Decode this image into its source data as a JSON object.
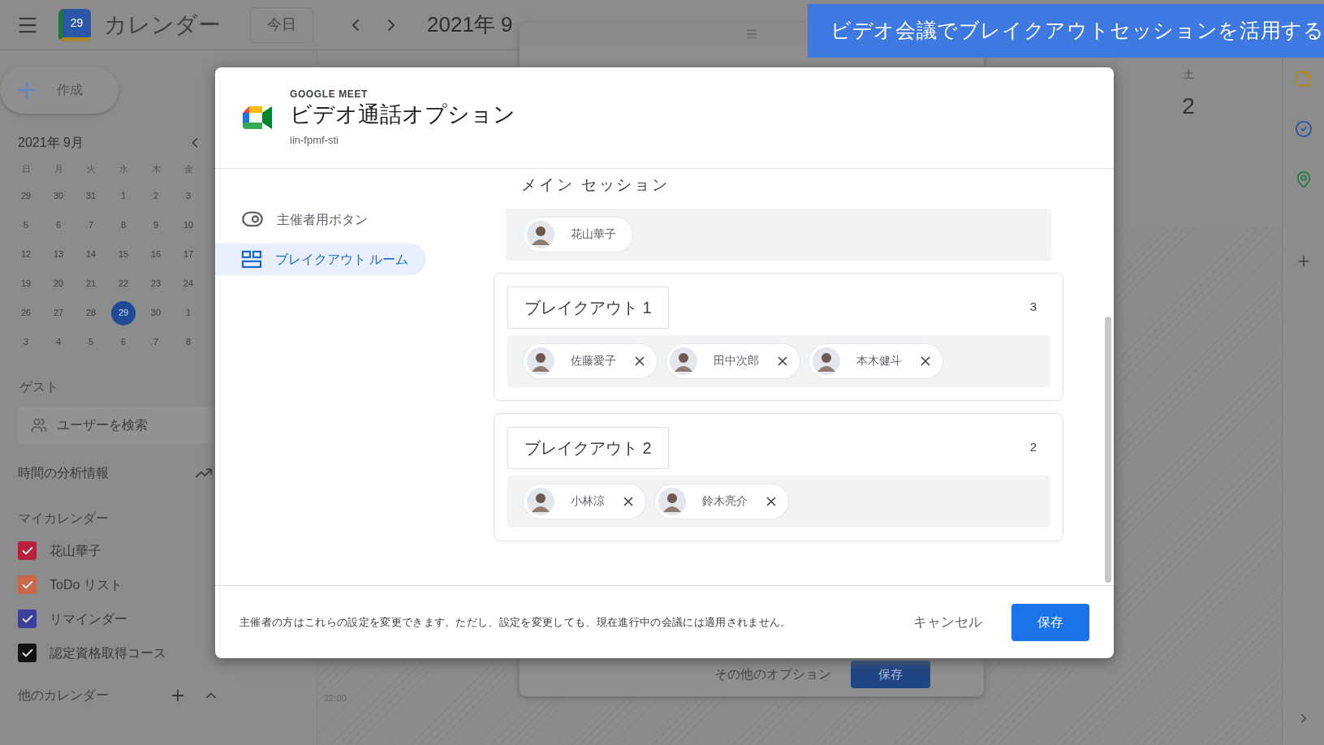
{
  "header": {
    "logo_text": "29",
    "app_name": "カレンダー",
    "today_button": "今日",
    "date_range": "2021年 9"
  },
  "banner": {
    "text": "ビデオ会議でブレイクアウトセッションを活用する"
  },
  "sidebar": {
    "create_button": "作成",
    "mini_calendar": {
      "title": "2021年 9月",
      "weekdays": [
        "日",
        "月",
        "火",
        "水",
        "木",
        "金"
      ],
      "weeks": [
        [
          {
            "label": "29",
            "selected": false
          },
          {
            "label": "30",
            "selected": false
          },
          {
            "label": "31",
            "selected": false
          },
          {
            "label": "1",
            "selected": false
          },
          {
            "label": "2",
            "selected": false
          },
          {
            "label": "3",
            "selected": false
          }
        ],
        [
          {
            "label": "5",
            "selected": false
          },
          {
            "label": "6",
            "selected": false
          },
          {
            "label": "7",
            "selected": false
          },
          {
            "label": "8",
            "selected": false
          },
          {
            "label": "9",
            "selected": false
          },
          {
            "label": "10",
            "selected": false
          }
        ],
        [
          {
            "label": "12",
            "selected": false
          },
          {
            "label": "13",
            "selected": false
          },
          {
            "label": "14",
            "selected": false
          },
          {
            "label": "15",
            "selected": false
          },
          {
            "label": "16",
            "selected": false
          },
          {
            "label": "17",
            "selected": false
          }
        ],
        [
          {
            "label": "19",
            "selected": false
          },
          {
            "label": "20",
            "selected": false
          },
          {
            "label": "21",
            "selected": false
          },
          {
            "label": "22",
            "selected": false
          },
          {
            "label": "23",
            "selected": false
          },
          {
            "label": "24",
            "selected": false
          }
        ],
        [
          {
            "label": "26",
            "selected": false
          },
          {
            "label": "27",
            "selected": false
          },
          {
            "label": "28",
            "selected": false
          },
          {
            "label": "29",
            "selected": true
          },
          {
            "label": "30",
            "selected": false
          },
          {
            "label": "1",
            "selected": false
          }
        ],
        [
          {
            "label": "3",
            "selected": false
          },
          {
            "label": "4",
            "selected": false
          },
          {
            "label": "5",
            "selected": false
          },
          {
            "label": "6",
            "selected": false
          },
          {
            "label": "7",
            "selected": false
          },
          {
            "label": "8",
            "selected": false
          }
        ]
      ]
    },
    "guests": {
      "title": "ゲスト",
      "search_placeholder": "ユーザーを検索"
    },
    "time_insights": "時間の分析情報",
    "my_calendars": {
      "title": "マイカレンダー",
      "items": [
        {
          "label": "花山華子",
          "checked": true,
          "color": "#b5213f"
        },
        {
          "label": "ToDo リスト",
          "checked": true,
          "color": "#c86a4a"
        },
        {
          "label": "リマインダー",
          "checked": true,
          "color": "#3a3f9a"
        },
        {
          "label": "認定資格取得コース",
          "checked": true,
          "color": "#111111"
        }
      ]
    },
    "other_calendars": {
      "title": "他のカレンダー"
    }
  },
  "grid": {
    "day_label": "土",
    "day_number": "2",
    "time_label": "22:00"
  },
  "event_popup": {
    "more_options": "その他のオプション",
    "save_button": "保存"
  },
  "dialog": {
    "eyebrow": "GOOGLE MEET",
    "title": "ビデオ通話オプション",
    "meeting_code": "iin-fpmf-sti",
    "nav": [
      {
        "label": "主催者用ボタン",
        "kind": "toggle",
        "selected": false
      },
      {
        "label": "ブレイクアウト ルーム",
        "kind": "rooms",
        "selected": true
      }
    ],
    "main_session": {
      "title": "メイン セッション",
      "participants": [
        {
          "name": "花山華子"
        }
      ]
    },
    "rooms": [
      {
        "name": "ブレイクアウト 1",
        "count": "3",
        "participants": [
          {
            "name": "佐藤愛子"
          },
          {
            "name": "田中次郎"
          },
          {
            "name": "本木健斗"
          }
        ]
      },
      {
        "name": "ブレイクアウト 2",
        "count": "2",
        "participants": [
          {
            "name": "小林涼"
          },
          {
            "name": "鈴木亮介"
          }
        ]
      }
    ],
    "footer_note": "主催者の方はこれらの設定を変更できます。ただし、設定を変更しても、現在進行中の会議には適用されません。",
    "cancel_button": "キャンセル",
    "save_button": "保存"
  }
}
